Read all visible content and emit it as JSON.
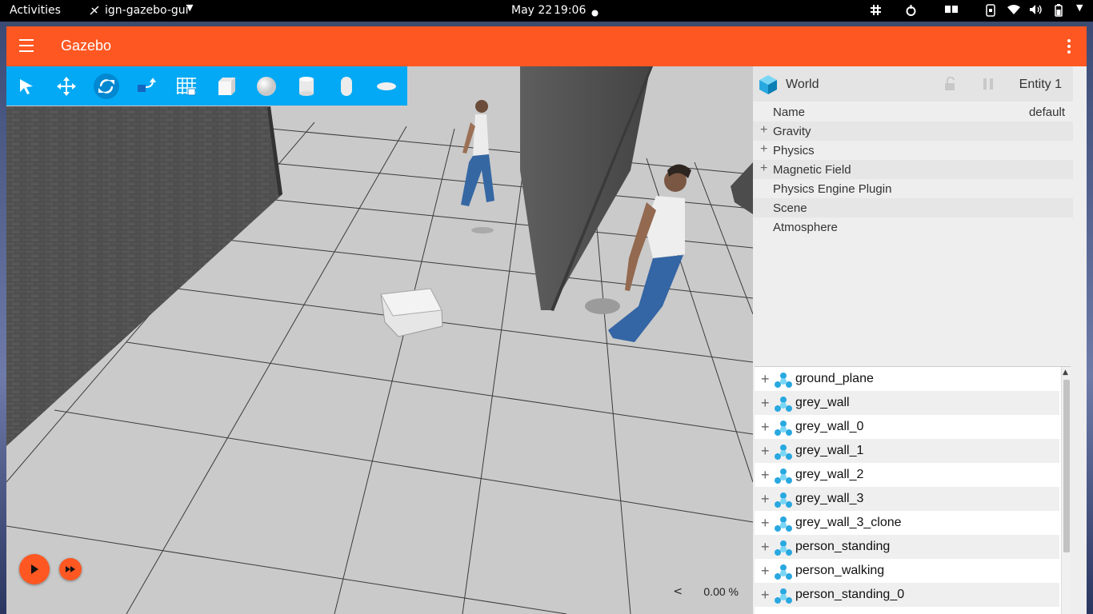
{
  "topbar": {
    "activities": "Activities",
    "app_menu": "ign-gazebo-gui",
    "clock_date": "May 22",
    "clock_time": "19:06"
  },
  "window": {
    "title": "Gazebo",
    "accent_color": "#fe5722",
    "toolbar_color": "#03a9f4"
  },
  "toolbar": {
    "tools": [
      "select-icon",
      "translate-icon",
      "rotate-icon",
      "transform-control-icon",
      "grid-snap-icon",
      "box-icon",
      "sphere-icon",
      "cylinder-icon",
      "capsule-icon",
      "ellipsoid-icon"
    ],
    "active_tool": "rotate-icon"
  },
  "scene": {
    "rtf_value": "0.00 %",
    "collapse_arrow": "<"
  },
  "component_inspector": {
    "title": "World",
    "entity_label": "Entity 1",
    "properties": [
      {
        "label": "Name",
        "value": "default",
        "expandable": false
      },
      {
        "label": "Gravity",
        "expandable": true
      },
      {
        "label": "Physics",
        "expandable": true
      },
      {
        "label": "Magnetic Field",
        "expandable": true
      },
      {
        "label": "Physics Engine Plugin",
        "expandable": false
      },
      {
        "label": "Scene",
        "expandable": false
      },
      {
        "label": "Atmosphere",
        "expandable": false
      }
    ]
  },
  "entity_tree": {
    "items": [
      "ground_plane",
      "grey_wall",
      "grey_wall_0",
      "grey_wall_1",
      "grey_wall_2",
      "grey_wall_3",
      "grey_wall_3_clone",
      "person_standing",
      "person_walking",
      "person_standing_0"
    ]
  }
}
